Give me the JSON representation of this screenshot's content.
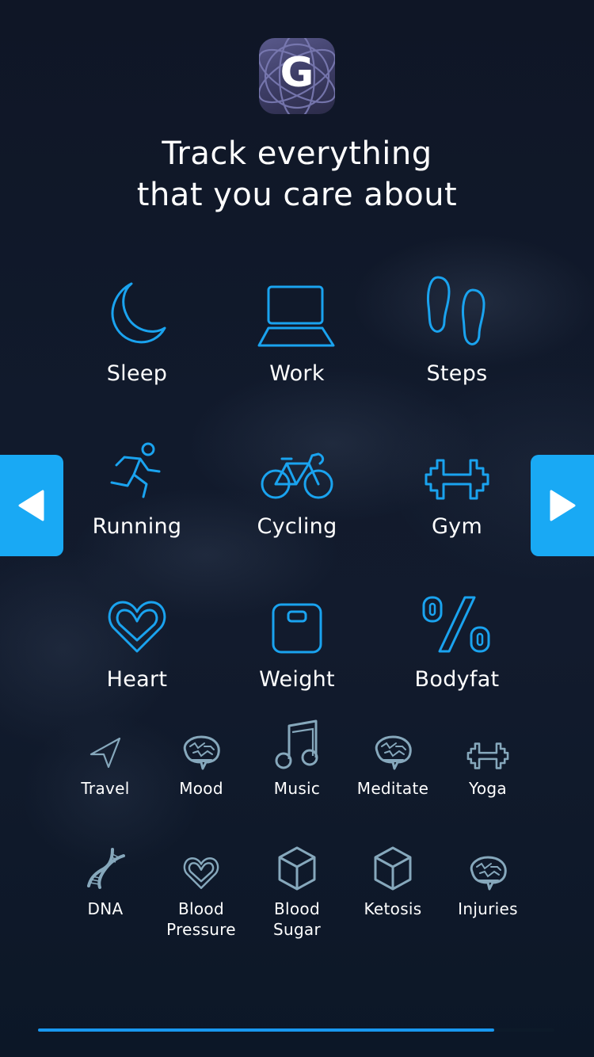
{
  "app": {
    "logo_letter": "G",
    "logo_icon": "app-logo-icon"
  },
  "headline": {
    "line1": "Track everything",
    "line2": "that you care about"
  },
  "colors": {
    "accent": "#19a9f4",
    "icon_primary": "#1aa3ef",
    "icon_secondary": "#86a8bc",
    "background": "#0f1626",
    "progress": "#1898f0"
  },
  "primary_trackers": [
    {
      "label": "Sleep",
      "icon": "moon-icon"
    },
    {
      "label": "Work",
      "icon": "laptop-icon"
    },
    {
      "label": "Steps",
      "icon": "footprints-icon"
    },
    {
      "label": "Running",
      "icon": "runner-icon"
    },
    {
      "label": "Cycling",
      "icon": "bicycle-icon"
    },
    {
      "label": "Gym",
      "icon": "dumbbell-icon"
    },
    {
      "label": "Heart",
      "icon": "heart-icon"
    },
    {
      "label": "Weight",
      "icon": "scale-icon"
    },
    {
      "label": "Bodyfat",
      "icon": "percent-icon"
    }
  ],
  "secondary_trackers": [
    {
      "label": "Travel",
      "icon": "navigation-arrow-icon"
    },
    {
      "label": "Mood",
      "icon": "brain-icon"
    },
    {
      "label": "Music",
      "icon": "music-note-icon"
    },
    {
      "label": "Meditate",
      "icon": "brain-icon"
    },
    {
      "label": "Yoga",
      "icon": "dumbbell-icon"
    },
    {
      "label": "DNA",
      "icon": "dna-icon"
    },
    {
      "label": "Blood\nPressure",
      "line1": "Blood",
      "line2": "Pressure",
      "icon": "heart-icon"
    },
    {
      "label": "Blood\nSugar",
      "line1": "Blood",
      "line2": "Sugar",
      "icon": "cube-icon"
    },
    {
      "label": "Ketosis",
      "icon": "cube-icon"
    },
    {
      "label": "Injuries",
      "icon": "brain-icon"
    }
  ],
  "navigation": {
    "prev_icon": "triangle-left-icon",
    "next_icon": "triangle-right-icon"
  },
  "progress": {
    "fraction": 0.884
  }
}
